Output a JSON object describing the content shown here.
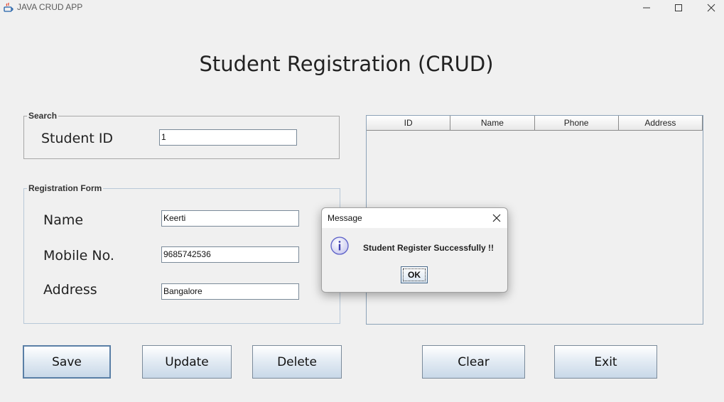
{
  "window": {
    "title": "JAVA CRUD APP",
    "icon": "java-icon",
    "controls": [
      "minimize-icon",
      "maximize-icon",
      "close-icon"
    ]
  },
  "page": {
    "title": "Student Registration (CRUD)"
  },
  "search": {
    "legend": "Search",
    "student_id_label": "Student ID",
    "student_id_value": "1"
  },
  "registration": {
    "legend": "Registration Form",
    "name_label": "Name",
    "name_value": "Keerti",
    "mobile_label": "Mobile No.",
    "mobile_value": "9685742536",
    "address_label": "Address",
    "address_value": "Bangalore"
  },
  "table": {
    "columns": [
      "ID",
      "Name",
      "Phone",
      "Address"
    ],
    "rows": []
  },
  "buttons": {
    "save": "Save",
    "update": "Update",
    "delete": "Delete",
    "clear": "Clear",
    "exit": "Exit"
  },
  "dialog": {
    "title": "Message",
    "icon": "info-icon",
    "message": "Student Register Successfully !!",
    "ok_label": "OK"
  },
  "colors": {
    "background": "#f0f0f0",
    "button_gradient_bottom": "#c8d8e8",
    "focused_button_border": "#5a7fa6",
    "info_icon": "#5b5fc7"
  }
}
